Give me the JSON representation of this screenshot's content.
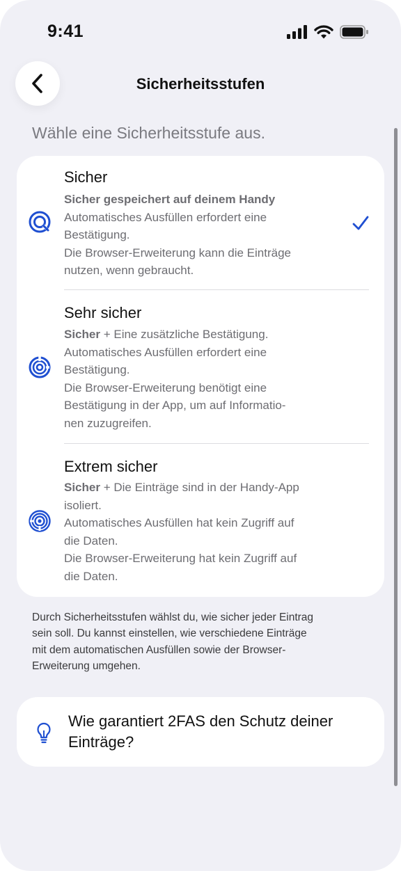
{
  "status_bar": {
    "time": "9:41"
  },
  "nav": {
    "back_icon": "chevron-left-icon",
    "title": "Sicherheitsstufen"
  },
  "section": {
    "title": "Wähle eine Sicherheitsstufe aus."
  },
  "options": [
    {
      "title": "Sicher",
      "icon": "secure-tier-icon",
      "selected": true,
      "lines": [
        "Sicher gespeichert auf deinem Handy",
        "Automatisches Ausfüllen erfordert eine",
        "Bestätigung.",
        "Die Browser-Erweiterung kann die Einträge",
        "nutzen, wenn gebraucht."
      ]
    },
    {
      "title": "Sehr sicher",
      "icon": "high-secure-tier-icon",
      "selected": false,
      "bold_prefix": "Sicher",
      "lines": [
        " + Eine zusätzliche Bestätigung.",
        "Automatisches Ausfüllen erfordert eine",
        "Bestätigung.",
        "Die Browser-Erweiterung benötigt eine",
        "Bestätigung in der App, um auf Informatio-",
        "nen zuzugreifen."
      ]
    },
    {
      "title": "Extrem sicher",
      "icon": "top-secret-tier-icon",
      "selected": false,
      "bold_prefix": "Sicher",
      "lines": [
        " + Die Einträge sind in der Handy-App",
        "isoliert.",
        "Automatisches Ausfüllen hat kein Zugriff auf",
        "die Daten.",
        "Die Browser-Erweiterung hat kein Zugriff auf",
        "die Daten."
      ]
    }
  ],
  "footnote": [
    "Durch Sicherheitsstufen wählst du, wie sicher jeder Eintrag",
    "sein soll. Du kannst einstellen, wie verschiedene Einträge",
    "mit dem automatischen Ausfüllen sowie der Browser-",
    "Erweiterung umgehen."
  ],
  "faq": {
    "icon": "lightbulb-icon",
    "lines": [
      "Wie garantiert 2FAS den Schutz deiner",
      "Einträge?"
    ]
  },
  "colors": {
    "accent": "#1f4fd1",
    "background": "#f0f0f6",
    "card": "#ffffff",
    "secondary_text": "#6d6d72"
  }
}
